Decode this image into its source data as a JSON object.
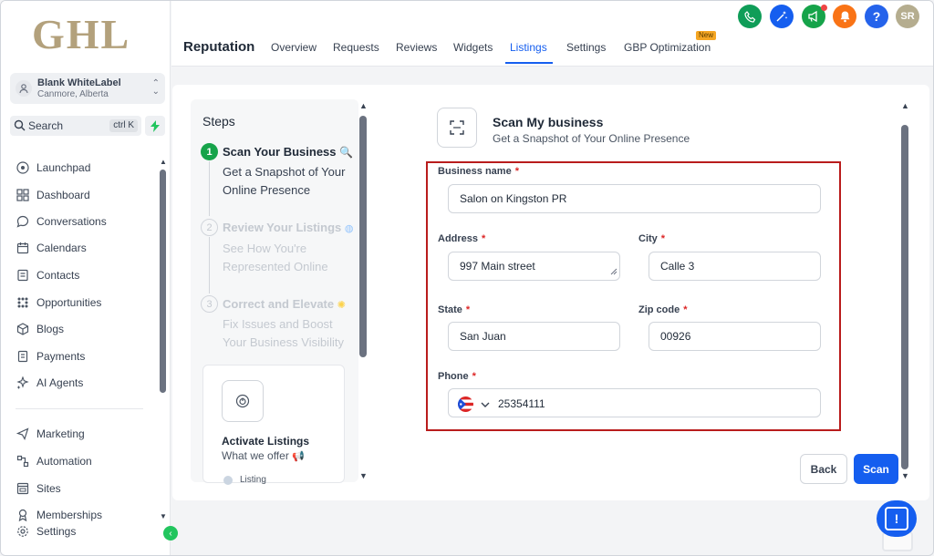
{
  "logo": "GHL",
  "account": {
    "name": "Blank WhiteLabel",
    "location": "Canmore, Alberta"
  },
  "search": {
    "label": "Search",
    "shortcut": "ctrl K"
  },
  "sidebar": {
    "items": [
      {
        "label": "Launchpad",
        "icon": "launchpad-icon"
      },
      {
        "label": "Dashboard",
        "icon": "dashboard-icon"
      },
      {
        "label": "Conversations",
        "icon": "chat-icon"
      },
      {
        "label": "Calendars",
        "icon": "calendar-icon"
      },
      {
        "label": "Contacts",
        "icon": "contacts-icon"
      },
      {
        "label": "Opportunities",
        "icon": "opportunities-icon"
      },
      {
        "label": "Blogs",
        "icon": "blogs-icon"
      },
      {
        "label": "Payments",
        "icon": "payments-icon"
      },
      {
        "label": "AI Agents",
        "icon": "ai-agents-icon"
      },
      {
        "label": "Marketing",
        "icon": "marketing-icon"
      },
      {
        "label": "Automation",
        "icon": "automation-icon"
      },
      {
        "label": "Sites",
        "icon": "sites-icon"
      },
      {
        "label": "Memberships",
        "icon": "memberships-icon"
      },
      {
        "label": "Settings",
        "icon": "settings-icon"
      }
    ]
  },
  "header": {
    "title": "Reputation",
    "tabs": [
      {
        "label": "Overview"
      },
      {
        "label": "Requests"
      },
      {
        "label": "Reviews"
      },
      {
        "label": "Widgets"
      },
      {
        "label": "Listings",
        "active": true
      },
      {
        "label": "Settings"
      },
      {
        "label": "GBP Optimization"
      }
    ],
    "new_badge": "New",
    "avatar_initials": "SR",
    "colors": {
      "phone": "#0f9d58",
      "magic": "#155eef",
      "megaphone": "#16a34a",
      "bell": "#f97316",
      "help": "#2563eb",
      "avatar": "#b5ad8f"
    }
  },
  "steps": {
    "title": "Steps",
    "items": [
      {
        "num": "1",
        "title": "Scan Your Business",
        "desc_line1": "Get a Snapshot of Your",
        "desc_line2": "Online Presence",
        "active": true
      },
      {
        "num": "2",
        "title": "Review Your Listings",
        "desc_line1": "See How You're",
        "desc_line2": "Represented Online",
        "active": false
      },
      {
        "num": "3",
        "title": "Correct and Elevate",
        "desc_line1": "Fix Issues and Boost",
        "desc_line2": "Your Business Visibility",
        "active": false
      }
    ],
    "activate": {
      "title": "Activate Listings",
      "desc": "What we offer",
      "list_item": "Listing"
    }
  },
  "form": {
    "title": "Scan My business",
    "subtitle": "Get a Snapshot of Your Online Presence",
    "business_name": {
      "label": "Business name",
      "value": "Salon on Kingston PR"
    },
    "address": {
      "label": "Address",
      "value": "997 Main street"
    },
    "city": {
      "label": "City",
      "value": "Calle 3"
    },
    "state": {
      "label": "State",
      "value": "San Juan"
    },
    "zip": {
      "label": "Zip code",
      "value": "00926"
    },
    "phone": {
      "label": "Phone",
      "value": "25354111",
      "country": "Puerto Rico"
    },
    "required_mark": "*"
  },
  "buttons": {
    "back": "Back",
    "scan": "Scan"
  },
  "accent_color": "#155eef"
}
